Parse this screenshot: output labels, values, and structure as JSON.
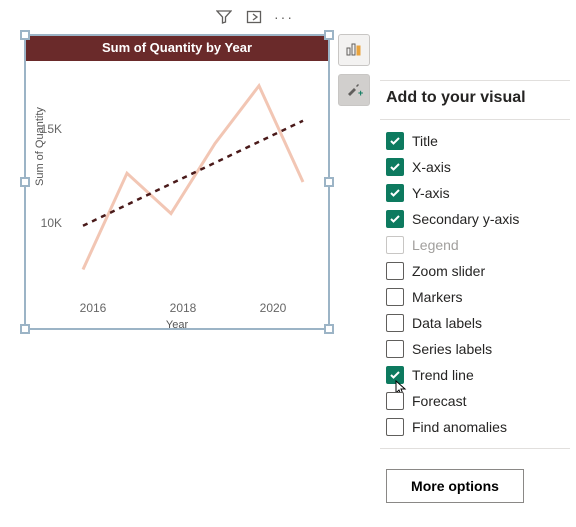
{
  "top_icons": {
    "filter": "filter-icon",
    "focus": "focus-mode-icon",
    "more": "more-icon"
  },
  "visual": {
    "title": "Sum of Quantity by Year",
    "y_axis_label": "Sum of Quantity",
    "x_axis_label": "Year",
    "y_ticks": [
      "15K",
      "10K"
    ],
    "x_ticks": [
      "2016",
      "2018",
      "2020"
    ]
  },
  "chart_data": {
    "type": "line",
    "xlabel": "Year",
    "ylabel": "Sum of Quantity",
    "title": "Sum of Quantity by Year",
    "x": [
      2016,
      2017,
      2018,
      2019,
      2020,
      2021
    ],
    "values": [
      7000,
      12500,
      10200,
      14200,
      17500,
      12000
    ],
    "ylim": [
      6000,
      18000
    ],
    "trend_line": {
      "start_y": 9500,
      "end_y": 15500
    },
    "series_color": "#f2c6b4",
    "trend_color": "#4a1a1a"
  },
  "side_tools": {
    "fields_tooltip": "Fields",
    "format_tooltip": "Format"
  },
  "panel": {
    "title": "Add to your visual",
    "options": [
      {
        "key": "title",
        "label": "Title",
        "checked": true,
        "disabled": false
      },
      {
        "key": "xaxis",
        "label": "X-axis",
        "checked": true,
        "disabled": false
      },
      {
        "key": "yaxis",
        "label": "Y-axis",
        "checked": true,
        "disabled": false
      },
      {
        "key": "secondary_y",
        "label": "Secondary y-axis",
        "checked": true,
        "disabled": false
      },
      {
        "key": "legend",
        "label": "Legend",
        "checked": false,
        "disabled": true
      },
      {
        "key": "zoom",
        "label": "Zoom slider",
        "checked": false,
        "disabled": false
      },
      {
        "key": "markers",
        "label": "Markers",
        "checked": false,
        "disabled": false
      },
      {
        "key": "data_labels",
        "label": "Data labels",
        "checked": false,
        "disabled": false
      },
      {
        "key": "series_labels",
        "label": "Series labels",
        "checked": false,
        "disabled": false
      },
      {
        "key": "trend_line",
        "label": "Trend line",
        "checked": true,
        "disabled": false
      },
      {
        "key": "forecast",
        "label": "Forecast",
        "checked": false,
        "disabled": false
      },
      {
        "key": "anomalies",
        "label": "Find anomalies",
        "checked": false,
        "disabled": false
      }
    ],
    "more_button": "More options"
  }
}
